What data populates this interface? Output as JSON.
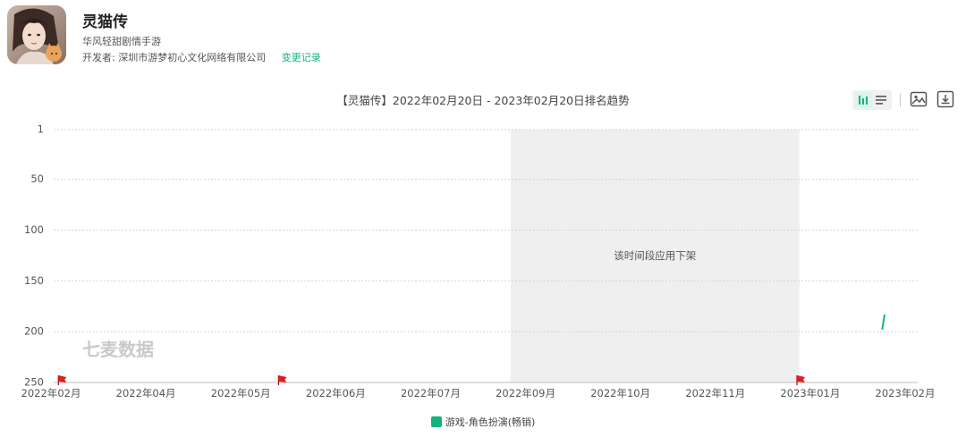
{
  "app": {
    "name": "灵猫传",
    "subtitle": "华风轻甜剧情手游",
    "developer_label": "开发者:",
    "developer_name": "深圳市游梦初心文化网络有限公司",
    "change_log": "变更记录"
  },
  "toolbar": {
    "icons": [
      "bar-chart-icon",
      "list-icon",
      "image-icon",
      "download-icon"
    ]
  },
  "watermark": "七麦数据",
  "chart_data": {
    "type": "line",
    "title": "【灵猫传】2022年02月20日 - 2023年02月20日排名趋势",
    "y_axis": {
      "ticks": [
        1,
        50,
        100,
        150,
        200,
        250
      ],
      "inverted": true,
      "range": [
        1,
        250
      ]
    },
    "x_axis": {
      "ticks": [
        "2022年02月",
        "2022年04月",
        "2022年05月",
        "2022年06月",
        "2022年07月",
        "2022年09月",
        "2022年10月",
        "2022年11月",
        "2023年01月",
        "2023年02月"
      ],
      "range": [
        "2022-02-20",
        "2023-02-20"
      ]
    },
    "grid": true,
    "series": [
      {
        "name": "游戏-角色扮演(畅销)",
        "color": "#14b37d",
        "points": [
          {
            "x": "2023-02-05",
            "y": 198
          },
          {
            "x": "2023-02-06",
            "y": 183
          }
        ]
      }
    ],
    "shaded_regions": [
      {
        "from": "2022-09-01",
        "to": "2023-01-01",
        "label": "该时间段应用下架",
        "color": "#efefef"
      }
    ],
    "event_markers": [
      {
        "x": "2022-02-22",
        "color": "#e11d1d"
      },
      {
        "x": "2022-05-26",
        "color": "#e11d1d"
      },
      {
        "x": "2022-12-31",
        "color": "#e11d1d"
      }
    ],
    "legend_position": "bottom"
  }
}
